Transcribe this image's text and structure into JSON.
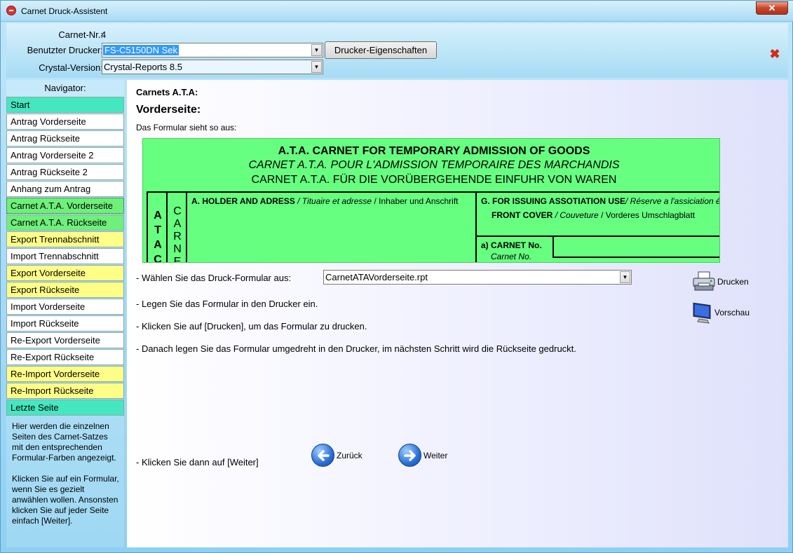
{
  "window": {
    "title": "Carnet Druck-Assistent"
  },
  "header": {
    "carnet_nr_label": "Carnet-Nr.:",
    "carnet_nr_value": "4",
    "printer_label": "Benutzter Drucker:",
    "printer_value": "FS-C5150DN Sek",
    "printer_props_label": "Drucker-Eigenschaften",
    "crystal_label": "Crystal-Version:",
    "crystal_value": "Crystal-Reports 8.5"
  },
  "navigator": {
    "title": "Navigator:",
    "items": [
      {
        "label": "Start",
        "color": "#45e7c0"
      },
      {
        "label": "Antrag Vorderseite",
        "color": "#ffffff"
      },
      {
        "label": "Antrag Rückseite",
        "color": "#ffffff"
      },
      {
        "label": "Antrag Vorderseite 2",
        "color": "#ffffff"
      },
      {
        "label": "Antrag Rückseite 2",
        "color": "#ffffff"
      },
      {
        "label": "Anhang zum Antrag",
        "color": "#ffffff"
      },
      {
        "label": "Carnet A.T.A. Vorderseite",
        "color": "#6ef07a",
        "selected": true
      },
      {
        "label": "Carnet A.T.A. Rückseite",
        "color": "#6ef07a"
      },
      {
        "label": "Export Trennabschnitt",
        "color": "#ffff88"
      },
      {
        "label": "Import Trennabschnitt",
        "color": "#ffffff"
      },
      {
        "label": "Export Vorderseite",
        "color": "#ffff88"
      },
      {
        "label": "Export Rückseite",
        "color": "#ffff88"
      },
      {
        "label": "Import Vorderseite",
        "color": "#ffffff"
      },
      {
        "label": "Import Rückseite",
        "color": "#ffffff"
      },
      {
        "label": "Re-Export Vorderseite",
        "color": "#ffffff"
      },
      {
        "label": "Re-Export Rückseite",
        "color": "#ffffff"
      },
      {
        "label": "Re-Import Vorderseite",
        "color": "#ffff88"
      },
      {
        "label": "Re-Import Rückseite",
        "color": "#ffff88"
      },
      {
        "label": "Letzte Seite",
        "color": "#45e7c0"
      }
    ],
    "help_text_1": "Hier werden die einzelnen Seiten des Carnet-Satzes mit den entsprechenden Formular-Farben angezeigt.",
    "help_text_2": "Klicken Sie auf ein Formular, wenn Sie es gezielt anwählen wollen. Ansonsten klicken Sie auf jeder Seite einfach [Weiter]."
  },
  "main": {
    "carnets_title": "Carnets A.T.A:",
    "section_title": "Vorderseite:",
    "intro": "Das Formular sieht so aus:",
    "preview": {
      "title_en": "A.T.A. CARNET FOR TEMPORARY ADMISSION OF GOODS",
      "title_fr": "CARNET A.T.A. POUR L'ADMISSION TEMPORAIRE DES MARCHANDIS",
      "title_de": "CARNET A.T.A. FÜR DIE VORÜBERGEHENDE EINFUHR VON WAREN",
      "ata_vertical": "A T A C",
      "carne_vertical": "C A R N E",
      "holder_bold": "A. HOLDER AND ADRESS",
      "holder_fr": "/ Tituaire et adresse",
      "holder_de": "/ Inhaber und Anschrift",
      "g_bold": "G. FOR ISSUING ASSOTIATION USE",
      "g_fr": "/ Réserve a l'assiciation émettrice",
      "front_bold": "FRONT COVER",
      "front_fr": "/ Couveture",
      "front_de": "/ Vorderes Umschlagblatt",
      "carnet_no_bold": "a) CARNET No.",
      "carnet_no_fr": "Carnet No."
    },
    "choose_label": "- Wählen Sie das Druck-Formular aus:",
    "form_value": "CarnetATAVorderseite.rpt",
    "instr1": "- Legen Sie das Formular in den Drucker ein.",
    "instr2": "- Klicken Sie auf [Drucken], um das Formular zu drucken.",
    "instr3": "- Danach legen Sie das Formular umgedreht in den Drucker, im nächsten Schritt wird die Rückseite gedruckt.",
    "instr4": "- Klicken Sie dann auf [Weiter]",
    "print_label": "Drucken",
    "preview_label": "Vorschau",
    "back_label": "Zurück",
    "next_label": "Weiter"
  }
}
